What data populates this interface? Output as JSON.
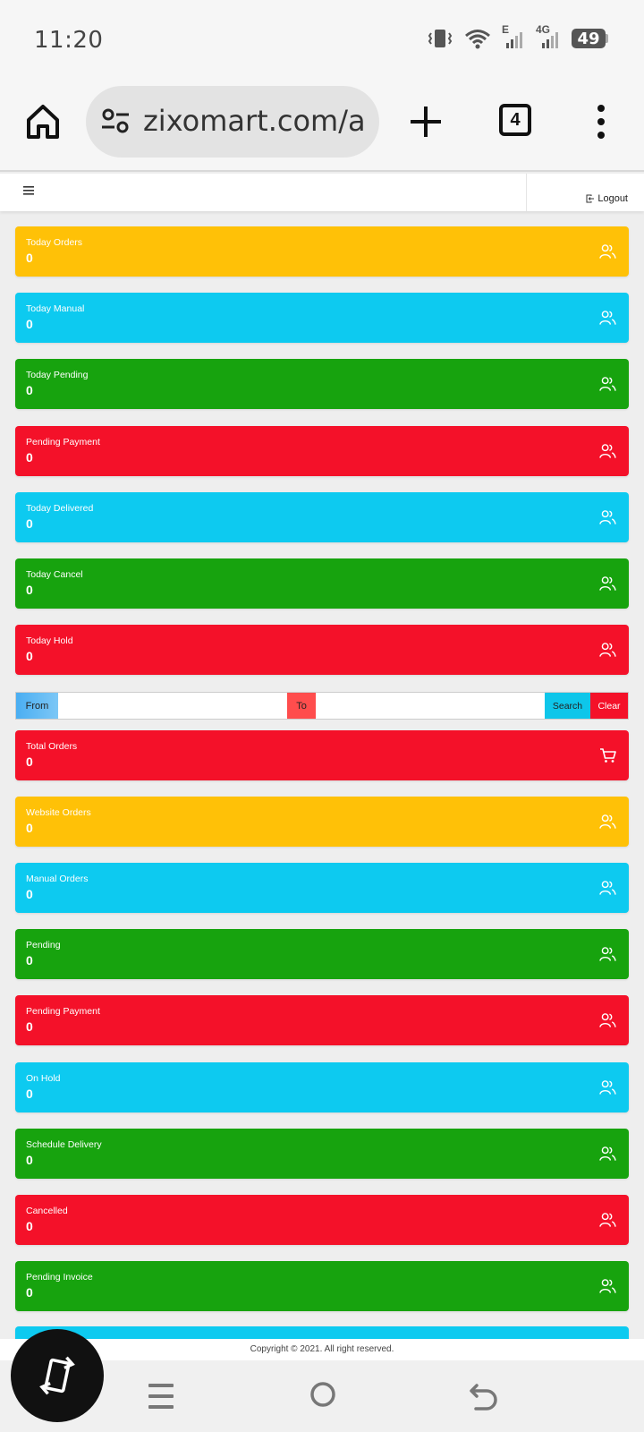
{
  "status_bar": {
    "time": "11:20",
    "network_e": "E",
    "network_4g": "4G",
    "battery": "49"
  },
  "browser": {
    "url": "zixomart.com/admin",
    "tab_count": "4"
  },
  "header": {
    "logout_label": "Logout"
  },
  "cards_top": [
    {
      "label": "Today Orders",
      "value": "0",
      "color": "#ffc107",
      "icon": "users-icon"
    },
    {
      "label": "Today Manual",
      "value": "0",
      "color": "#0dcaf0",
      "icon": "users-icon"
    },
    {
      "label": "Today Pending",
      "value": "0",
      "color": "#17a30e",
      "icon": "users-icon"
    },
    {
      "label": "Pending Payment",
      "value": "0",
      "color": "#f41129",
      "icon": "users-icon"
    },
    {
      "label": "Today Delivered",
      "value": "0",
      "color": "#0dcaf0",
      "icon": "users-icon"
    },
    {
      "label": "Today Cancel",
      "value": "0",
      "color": "#17a30e",
      "icon": "users-icon"
    },
    {
      "label": "Today Hold",
      "value": "0",
      "color": "#f41129",
      "icon": "users-icon"
    }
  ],
  "filter": {
    "from_label": "From",
    "to_label": "To",
    "search_label": "Search",
    "clear_label": "Clear"
  },
  "cards_bottom": [
    {
      "label": "Total Orders",
      "value": "0",
      "color": "#f41129",
      "icon": "cart-icon"
    },
    {
      "label": "Website Orders",
      "value": "0",
      "color": "#ffc107",
      "icon": "users-icon"
    },
    {
      "label": "Manual Orders",
      "value": "0",
      "color": "#0dcaf0",
      "icon": "users-icon"
    },
    {
      "label": "Pending",
      "value": "0",
      "color": "#17a30e",
      "icon": "users-icon"
    },
    {
      "label": "Pending Payment",
      "value": "0",
      "color": "#f41129",
      "icon": "users-icon"
    },
    {
      "label": "On Hold",
      "value": "0",
      "color": "#0dcaf0",
      "icon": "users-icon"
    },
    {
      "label": "Schedule Delivery",
      "value": "0",
      "color": "#17a30e",
      "icon": "users-icon"
    },
    {
      "label": "Cancelled",
      "value": "0",
      "color": "#f41129",
      "icon": "users-icon"
    },
    {
      "label": "Pending Invoice",
      "value": "0",
      "color": "#17a30e",
      "icon": "users-icon"
    }
  ],
  "footer": {
    "copyright": "Copyright © 2021. All right reserved."
  }
}
